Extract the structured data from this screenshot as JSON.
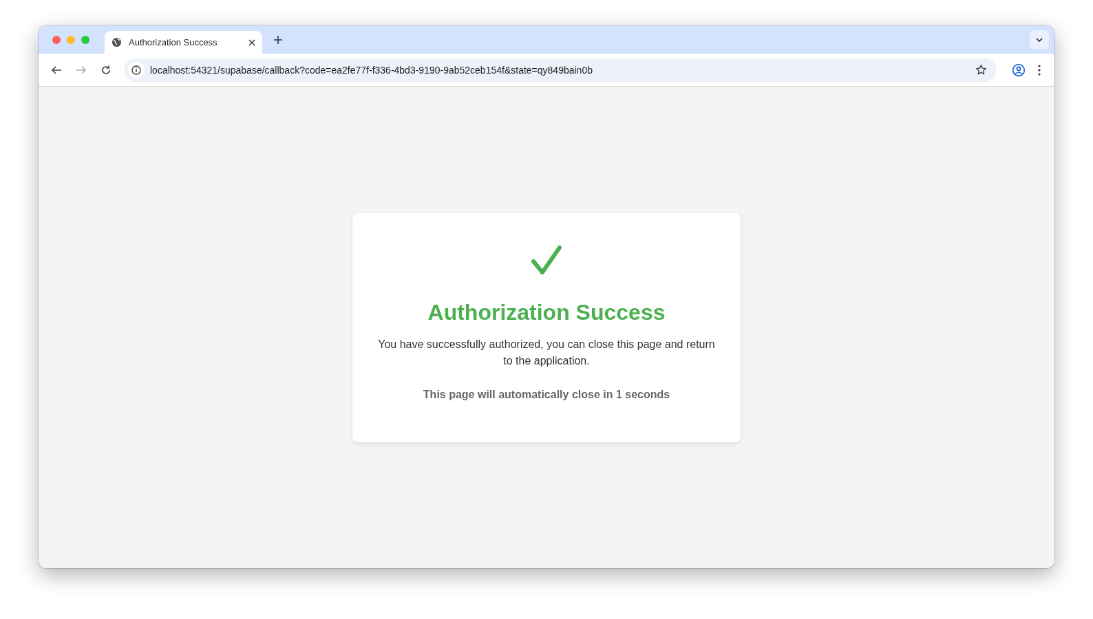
{
  "window": {
    "tabs": [
      {
        "title": "Authorization Success",
        "selected": true
      }
    ]
  },
  "toolbar": {
    "buttons": [
      {
        "kind": "back",
        "disabled": false
      },
      {
        "kind": "forward",
        "disabled": true
      },
      {
        "kind": "reload",
        "disabled": false
      }
    ],
    "url": "localhost:54321/supabase/callback?code=ea2fe77f-f336-4bd3-9190-9ab52ceb154f&state=qy849bain0b"
  },
  "card": {
    "title": "Authorization Success",
    "message": "You have successfully authorized, you can close this page and return to the application.",
    "countdown": "This page will automatically close in 1 seconds"
  }
}
